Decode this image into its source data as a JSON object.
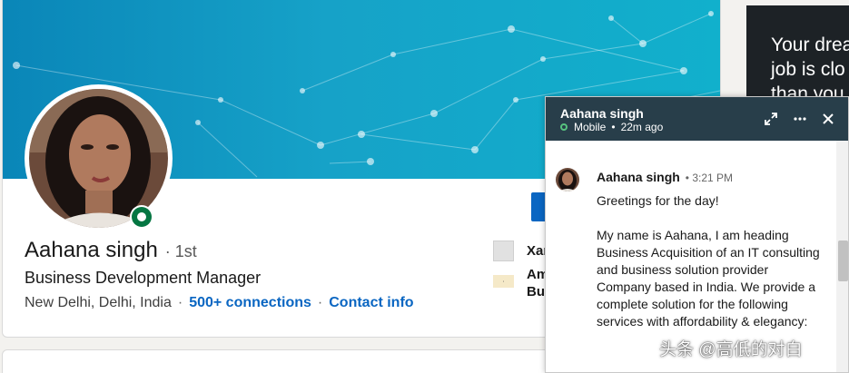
{
  "profile": {
    "name": "Aahana singh",
    "degree": "· 1st",
    "headline": "Business Development Manager",
    "location": "New Delhi, Delhi, India",
    "separator": "·",
    "connections": "500+ connections",
    "contact_info": "Contact info"
  },
  "experience": [
    {
      "text": "Xar"
    },
    {
      "text": "Am",
      "text2": "Bus"
    }
  ],
  "ad": {
    "line1": "Your drea",
    "line2": "job is clo",
    "line3": "than you"
  },
  "chat": {
    "header_name": "Aahana singh",
    "status": "Mobile",
    "bullet": "•",
    "last_seen": "22m ago",
    "message": {
      "sender": "Aahana singh",
      "time": "• 3:21 PM",
      "text": "Greetings for the day!\n\nMy name is Aahana, I am heading Business Acquisition of an IT consulting and business solution provider Company based in India. We provide a complete solution for the following services with affordability & elegancy:"
    }
  },
  "watermark": "头条 @高低的对白",
  "colors": {
    "banner": "#0a86b8",
    "link": "#0a66c2",
    "chat_header": "#283e4a",
    "online": "#057642"
  },
  "icons": {
    "expand": "expand-icon",
    "more": "more-icon",
    "close": "close-icon"
  }
}
